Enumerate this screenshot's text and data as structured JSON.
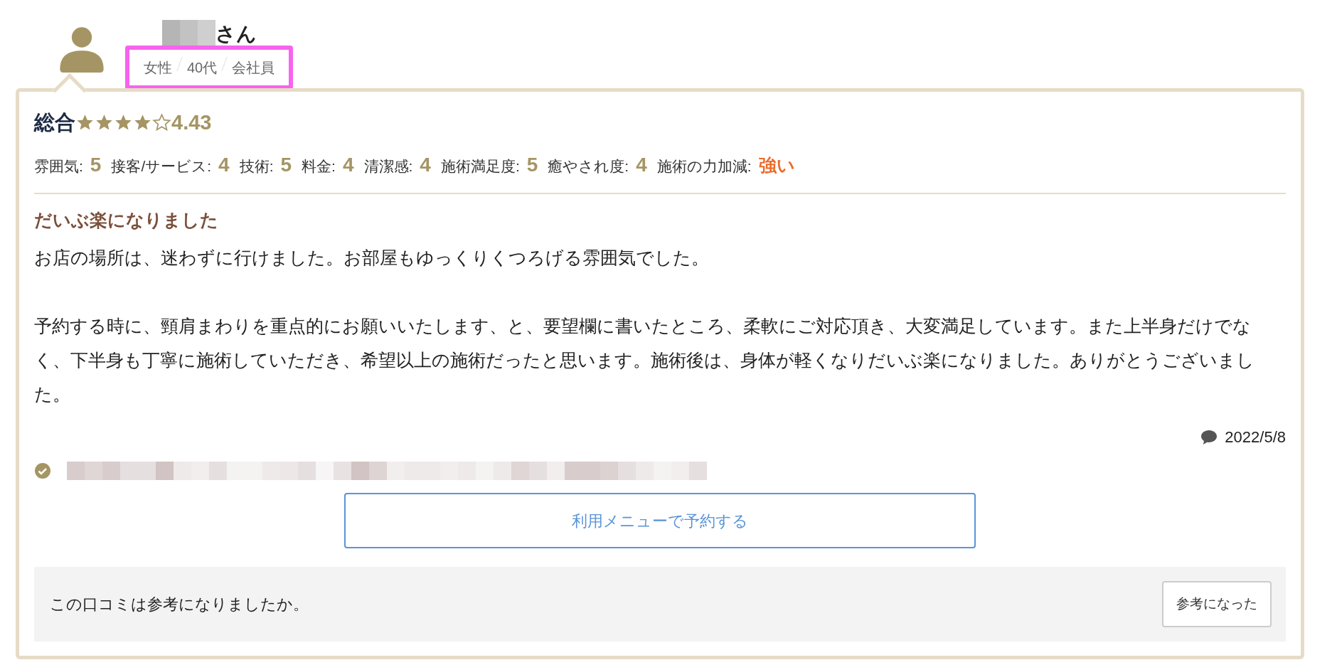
{
  "reviewer": {
    "name_suffix": "さん",
    "attributes": [
      "女性",
      "40代",
      "会社員"
    ],
    "highlighted": true
  },
  "overall": {
    "label": "総合",
    "stars": 4,
    "score": "4.43"
  },
  "ratings": [
    {
      "label": "雰囲気:",
      "value": "5",
      "kind": "number"
    },
    {
      "label": "接客/サービス:",
      "value": "4",
      "kind": "number"
    },
    {
      "label": "技術:",
      "value": "5",
      "kind": "number"
    },
    {
      "label": "料金:",
      "value": "4",
      "kind": "number"
    },
    {
      "label": "清潔感:",
      "value": "4",
      "kind": "number"
    },
    {
      "label": "施術満足度:",
      "value": "5",
      "kind": "number"
    },
    {
      "label": "癒やされ度:",
      "value": "4",
      "kind": "number"
    },
    {
      "label": "施術の力加減:",
      "value": "強い",
      "kind": "word"
    }
  ],
  "review": {
    "title": "だいぶ楽になりました",
    "paragraphs": [
      "お店の場所は、迷わずに行けました。お部屋もゆっくりくつろげる雰囲気でした。",
      "予約する時に、頸肩まわりを重点的にお願いいたします、と、要望欄に書いたところ、柔軟にご対応頂き、大変満足しています。また上半身だけでなく、下半身も丁寧に施術していただき、希望以上の施術だったと思います。施術後は、身体が軽くなりだいぶ楽になりました。ありがとうございました。"
    ],
    "date": "2022/5/8"
  },
  "book_button": "利用メニューで予約する",
  "helpful": {
    "question": "この口コミは参考になりましたか。",
    "button": "参考になった"
  }
}
